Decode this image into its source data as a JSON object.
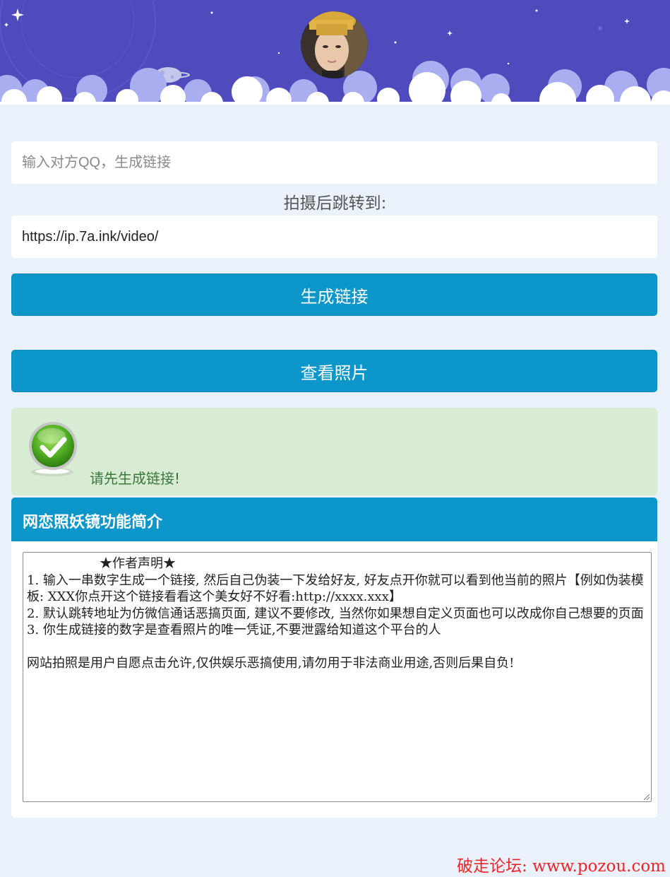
{
  "header": {
    "avatar_icon": "user-avatar-photo"
  },
  "form": {
    "qq_input": {
      "value": "",
      "placeholder": "输入对方QQ，生成链接"
    },
    "redirect_label": "拍摄后跳转到:",
    "redirect_input": {
      "value": "https://ip.7a.ink/video/"
    },
    "generate_button": "生成链接",
    "view_photos_button": "查看照片"
  },
  "notice": {
    "icon": "check-circle-icon",
    "message": "请先生成链接!"
  },
  "intro_panel": {
    "title": "网恋照妖镜功能简介",
    "text": "                  ★作者声明★\n1. 输入一串数字生成一个链接, 然后自己伪装一下发给好友, 好友点开你就可以看到他当前的照片【例如伪装模板: XXX你点开这个链接看看这个美女好不好看:http://xxxx.xxx】\n2. 默认跳转地址为仿微信通话恶搞页面, 建议不要修改, 当然你如果想自定义页面也可以改成你自己想要的页面\n3. 你生成链接的数字是查看照片的唯一凭证,不要泄露给知道这个平台的人\n\n网站拍照是用户自愿点击允许,仅供娱乐恶搞使用,请勿用于非法商业用途,否则后果自负!"
  },
  "watermark": "破走论坛: www.pozou.com",
  "colors": {
    "header_bg": "#4f4bbd",
    "button_bg": "#0c96c9",
    "notice_bg": "#d7ecd2",
    "notice_text": "#3c763d",
    "page_bg": "#eaf1fb",
    "watermark": "#e8272c"
  }
}
